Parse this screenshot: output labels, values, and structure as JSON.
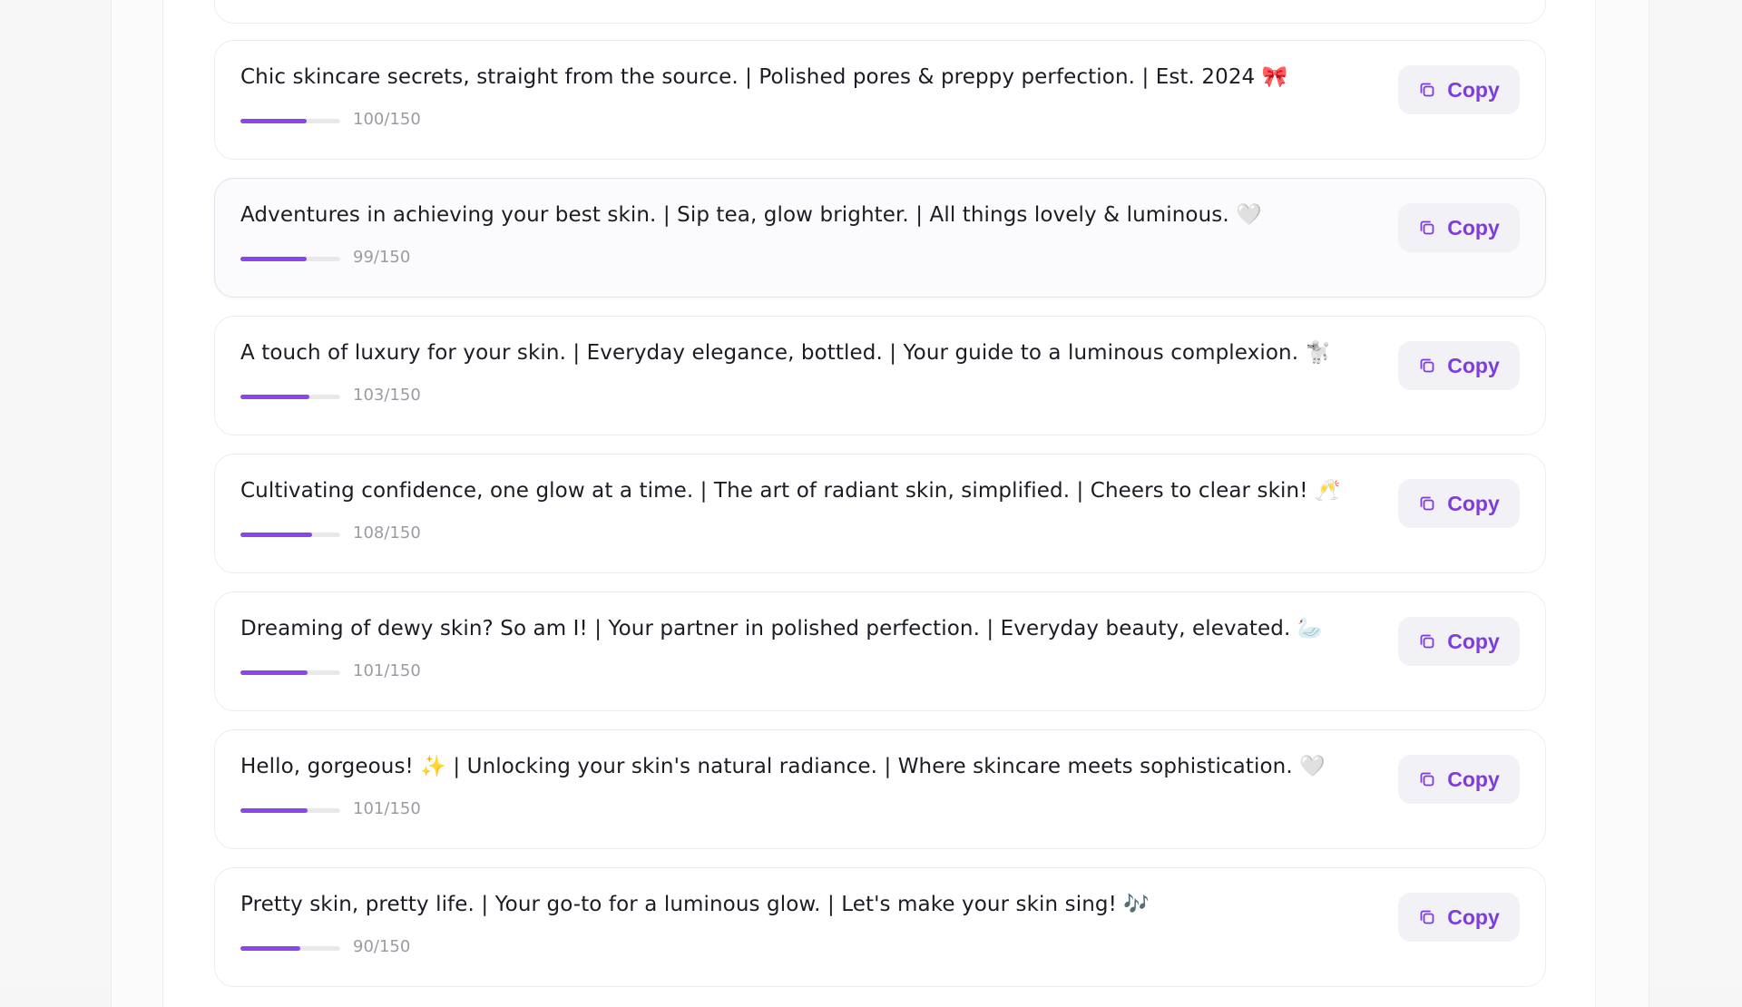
{
  "accent_color": "#8a46e8",
  "copy_label_color": "#7d3be0",
  "max_chars": 150,
  "bios": [
    {
      "text": "Chic skincare secrets, straight from the source. | Polished pores & preppy perfection. | Est. 2024 🎀",
      "count_label": "100/150",
      "count": 100,
      "copy_label": "Copy"
    },
    {
      "text": "Adventures in achieving your best skin. | Sip tea, glow brighter. | All things lovely & luminous. 🤍",
      "count_label": "99/150",
      "count": 99,
      "copy_label": "Copy"
    },
    {
      "text": "A touch of luxury for your skin. | Everyday elegance, bottled. | Your guide to a luminous complexion. 🐩",
      "count_label": "103/150",
      "count": 103,
      "copy_label": "Copy"
    },
    {
      "text": "Cultivating confidence, one glow at a time. | The art of radiant skin, simplified. | Cheers to clear skin! 🥂",
      "count_label": "108/150",
      "count": 108,
      "copy_label": "Copy"
    },
    {
      "text": "Dreaming of dewy skin? So am I! | Your partner in polished perfection. | Everyday beauty, elevated. 🦢",
      "count_label": "101/150",
      "count": 101,
      "copy_label": "Copy"
    },
    {
      "text": "Hello, gorgeous! ✨ | Unlocking your skin's natural radiance. | Where skincare meets sophistication. 🤍",
      "count_label": "101/150",
      "count": 101,
      "copy_label": "Copy"
    },
    {
      "text": "Pretty skin, pretty life. | Your go-to for a luminous glow. | Let's make your skin sing! 🎶",
      "count_label": "90/150",
      "count": 90,
      "copy_label": "Copy"
    }
  ]
}
